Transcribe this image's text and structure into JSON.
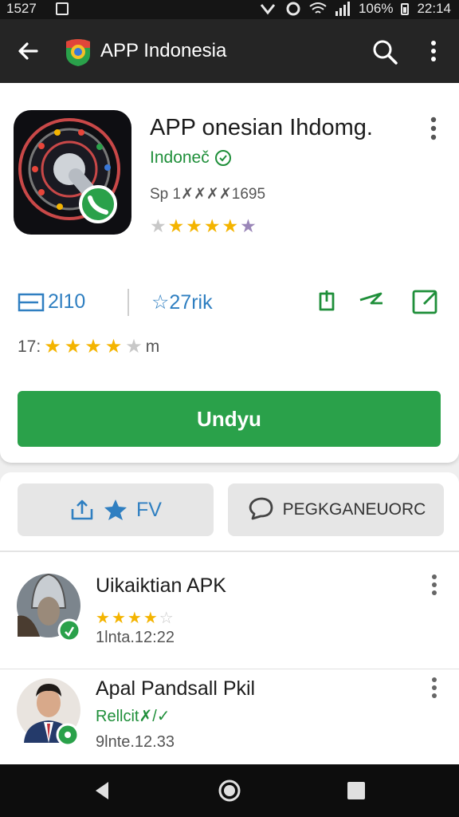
{
  "status_bar": {
    "time_left": "1527",
    "battery_text": "106%",
    "time_right": "22:14"
  },
  "app_bar": {
    "title": "APP Indonesia"
  },
  "app": {
    "name": "APP onesian Ihdomg.",
    "developer": "Indoneč",
    "size_text": "Sp 1✗✗✗✗1695",
    "rating_stars": 4.5
  },
  "stats": {
    "downloads": "2l10",
    "reviews": "☆27rik"
  },
  "rating_row": {
    "prefix": "17:",
    "stars": 3.5,
    "suffix": "m"
  },
  "install_label": "Undyu",
  "actions": {
    "share_label": "FV",
    "comment_label": "PEGKGANEUORC"
  },
  "list": [
    {
      "title": "Uikaiktian APK",
      "stars": 4,
      "date": "1lnta.12:22"
    },
    {
      "title": "Apal Pandsall Pkil",
      "subtitle": "Rellcit✗/✓",
      "date": "9lnte.12.33"
    }
  ],
  "colors": {
    "accent_green": "#2aa14a",
    "link_blue": "#2f7fc1",
    "star_gold": "#f4b400"
  }
}
